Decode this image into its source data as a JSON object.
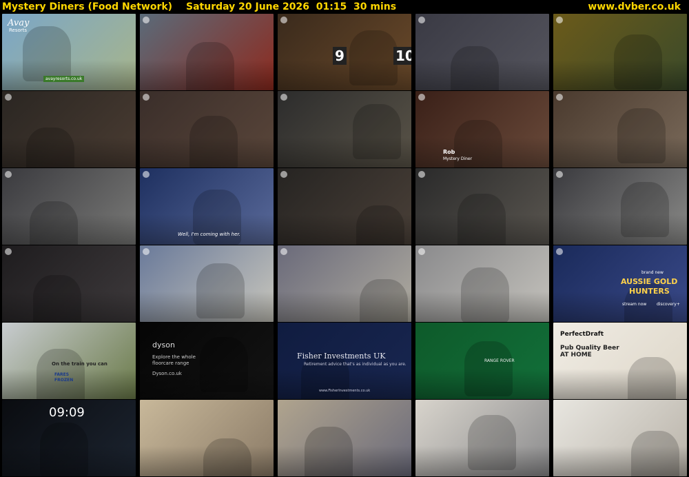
{
  "header": {
    "title": "Mystery Diners (Food Network)",
    "datetime": "Saturday 20 June 2026  01:15  30 mins",
    "site": "www.dvber.co.uk"
  },
  "thumbnails": [
    {
      "colors": [
        "#7aa6c8",
        "#a8b58a"
      ],
      "texts": [
        "Avay",
        "Resorts",
        "avayresorts.co.uk"
      ]
    },
    {
      "colors": [
        "#5a6b7a",
        "#8e2a1e"
      ],
      "texts": []
    },
    {
      "colors": [
        "#3a2a1c",
        "#6b4a2a"
      ],
      "texts": [
        "9",
        "10"
      ]
    },
    {
      "colors": [
        "#3a3a44",
        "#55555e"
      ],
      "texts": []
    },
    {
      "colors": [
        "#6b5a1a",
        "#3a4a2a"
      ],
      "texts": []
    },
    {
      "colors": [
        "#2a2622",
        "#4a3c32"
      ],
      "texts": []
    },
    {
      "colors": [
        "#3a2e2a",
        "#5a463a"
      ],
      "texts": []
    },
    {
      "colors": [
        "#2c2c2c",
        "#5a5448"
      ],
      "texts": []
    },
    {
      "colors": [
        "#3a2018",
        "#6a4a3a"
      ],
      "texts": [
        "Rob",
        "Mystery Diner"
      ]
    },
    {
      "colors": [
        "#4a3a2e",
        "#7a6a5a"
      ],
      "texts": []
    },
    {
      "colors": [
        "#3a3a3e",
        "#7a7a78"
      ],
      "texts": []
    },
    {
      "colors": [
        "#1e3060",
        "#5a6a9a"
      ],
      "texts": [
        "Well, I'm coming with her."
      ]
    },
    {
      "colors": [
        "#262422",
        "#4a4038"
      ],
      "texts": []
    },
    {
      "colors": [
        "#2a2a2a",
        "#5a5650"
      ],
      "texts": []
    },
    {
      "colors": [
        "#3a3a3e",
        "#8a8a88"
      ],
      "texts": []
    },
    {
      "colors": [
        "#1e1c1e",
        "#3e3a3c"
      ],
      "texts": []
    },
    {
      "colors": [
        "#6a7a9a",
        "#c8c6bc"
      ],
      "texts": []
    },
    {
      "colors": [
        "#6a6a7a",
        "#b0aca0"
      ],
      "texts": []
    },
    {
      "colors": [
        "#8a8a8c",
        "#c4c2bc"
      ],
      "texts": []
    },
    {
      "colors": [
        "#1a2a5a",
        "#3a4a8a"
      ],
      "texts": [
        "brand new",
        "AUSSIE GOLD",
        "HUNTERS",
        "stream now",
        "discovery+"
      ]
    },
    {
      "colors": [
        "#c8ccd0",
        "#6a7a48"
      ],
      "texts": [
        "On the train you can",
        "FARES",
        "FROZEN"
      ]
    },
    {
      "colors": [
        "#050505",
        "#141414"
      ],
      "texts": [
        "dyson",
        "Explore the whole",
        "floorcare range",
        "Dyson.co.uk"
      ]
    },
    {
      "colors": [
        "#101c40",
        "#182650"
      ],
      "texts": [
        "Fisher Investments UK",
        "Retirement advice that's as individual as you are.",
        "www.FisherInvestments.co.uk"
      ]
    },
    {
      "colors": [
        "#0e5a2a",
        "#12703a"
      ],
      "texts": [
        "RANGE ROVER"
      ]
    },
    {
      "colors": [
        "#f0ece4",
        "#ddd6c8"
      ],
      "texts": [
        "PerfectDraft",
        "Pub Quality Beer",
        "AT HOME"
      ]
    },
    {
      "colors": [
        "#0a0c10",
        "#1c2430"
      ],
      "texts": [
        "09:09"
      ]
    },
    {
      "colors": [
        "#c8b89a",
        "#8a7a66"
      ],
      "texts": []
    },
    {
      "colors": [
        "#b0a48e",
        "#6a6a7a"
      ],
      "texts": []
    },
    {
      "colors": [
        "#d8d4cc",
        "#8a8a8c"
      ],
      "texts": []
    },
    {
      "colors": [
        "#e8e6e0",
        "#b8b2a8"
      ],
      "texts": []
    }
  ]
}
